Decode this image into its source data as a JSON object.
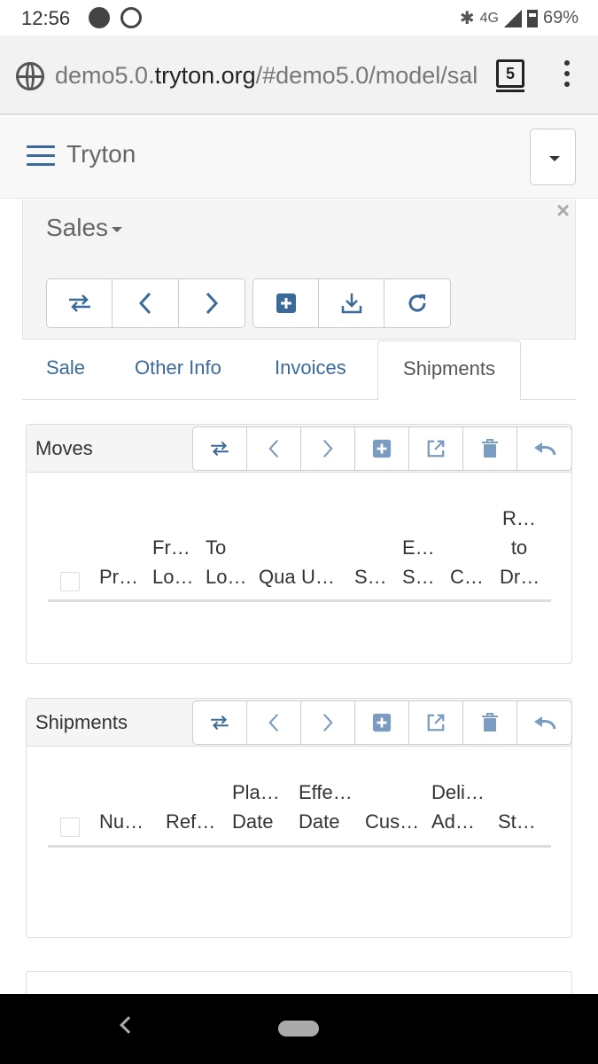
{
  "status_bar": {
    "time": "12:56",
    "network": "4G",
    "battery": "69%"
  },
  "browser": {
    "url_prefix": "demo5.0.",
    "url_host": "tryton.org",
    "url_path": "/#demo5.0/model/sal",
    "tab_count": "5"
  },
  "app": {
    "brand": "Tryton"
  },
  "sales_panel": {
    "title": "Sales"
  },
  "tabs": [
    {
      "label": "Sale",
      "active": false
    },
    {
      "label": "Other Info",
      "active": false
    },
    {
      "label": "Invoices",
      "active": false
    },
    {
      "label": "Shipments",
      "active": true
    }
  ],
  "moves": {
    "title": "Moves",
    "columns": [
      {
        "lines": [
          "Pr…"
        ]
      },
      {
        "lines": [
          "Fr…",
          "Lo…"
        ]
      },
      {
        "lines": [
          "To",
          "Lo…"
        ]
      },
      {
        "lines": [
          "Qua"
        ]
      },
      {
        "lines": [
          "U…"
        ]
      },
      {
        "lines": [
          "S…"
        ]
      },
      {
        "lines": [
          "E…",
          "S…"
        ]
      },
      {
        "lines": [
          "C…"
        ]
      },
      {
        "lines": [
          "R…",
          "to",
          "Dr…"
        ]
      }
    ]
  },
  "shipments": {
    "title": "Shipments",
    "columns": [
      {
        "lines": [
          "Nu…"
        ]
      },
      {
        "lines": [
          "Ref…"
        ]
      },
      {
        "lines": [
          "Pla…",
          "Date"
        ]
      },
      {
        "lines": [
          "Effe…",
          "Date"
        ]
      },
      {
        "lines": [
          "Cus…"
        ]
      },
      {
        "lines": [
          "Deli…",
          "Ad…"
        ]
      },
      {
        "lines": [
          "St…"
        ]
      }
    ]
  }
}
